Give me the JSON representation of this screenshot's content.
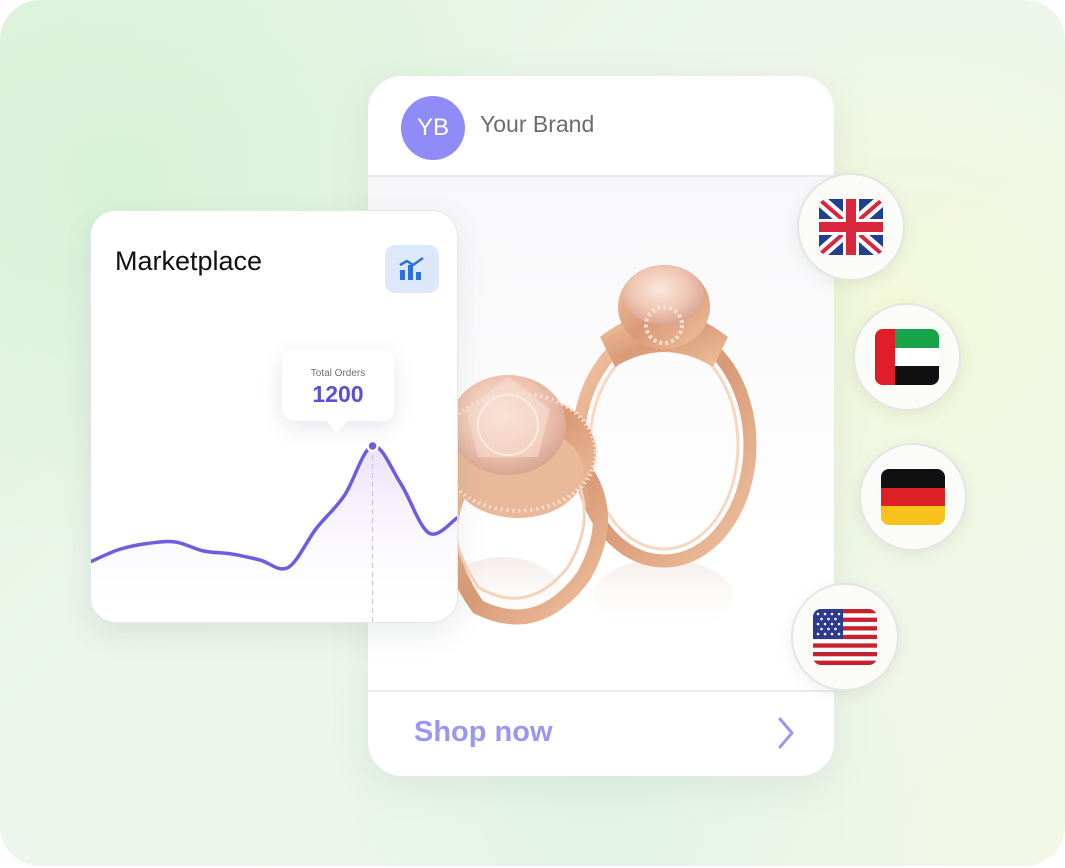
{
  "brand": {
    "initials": "YB",
    "name": "Your Brand",
    "avatar_color": "#8f8cf7"
  },
  "product": {
    "image_subject": "rose gold halo engagement rings",
    "cta_label": "Shop now",
    "cta_color": "#9a97f2",
    "cta_icon": "chevron-right-icon"
  },
  "marketplace": {
    "title": "Marketplace",
    "icon": "bar-chart-icon",
    "line_color": "#6f5ce0",
    "tooltip": {
      "label": "Total Orders",
      "value": "1200"
    }
  },
  "chart_data": {
    "type": "area",
    "series": [
      {
        "values": [
          430,
          510,
          550,
          560,
          500,
          480,
          440,
          390,
          650,
          870,
          1200,
          950,
          620,
          720
        ]
      }
    ],
    "highlight": {
      "index": 10,
      "value": 1200
    }
  },
  "flags": [
    {
      "country": "United Kingdom",
      "icon": "uk-flag-icon"
    },
    {
      "country": "United Arab Emirates",
      "icon": "uae-flag-icon"
    },
    {
      "country": "Germany",
      "icon": "germany-flag-icon"
    },
    {
      "country": "United States",
      "icon": "us-flag-icon"
    }
  ]
}
